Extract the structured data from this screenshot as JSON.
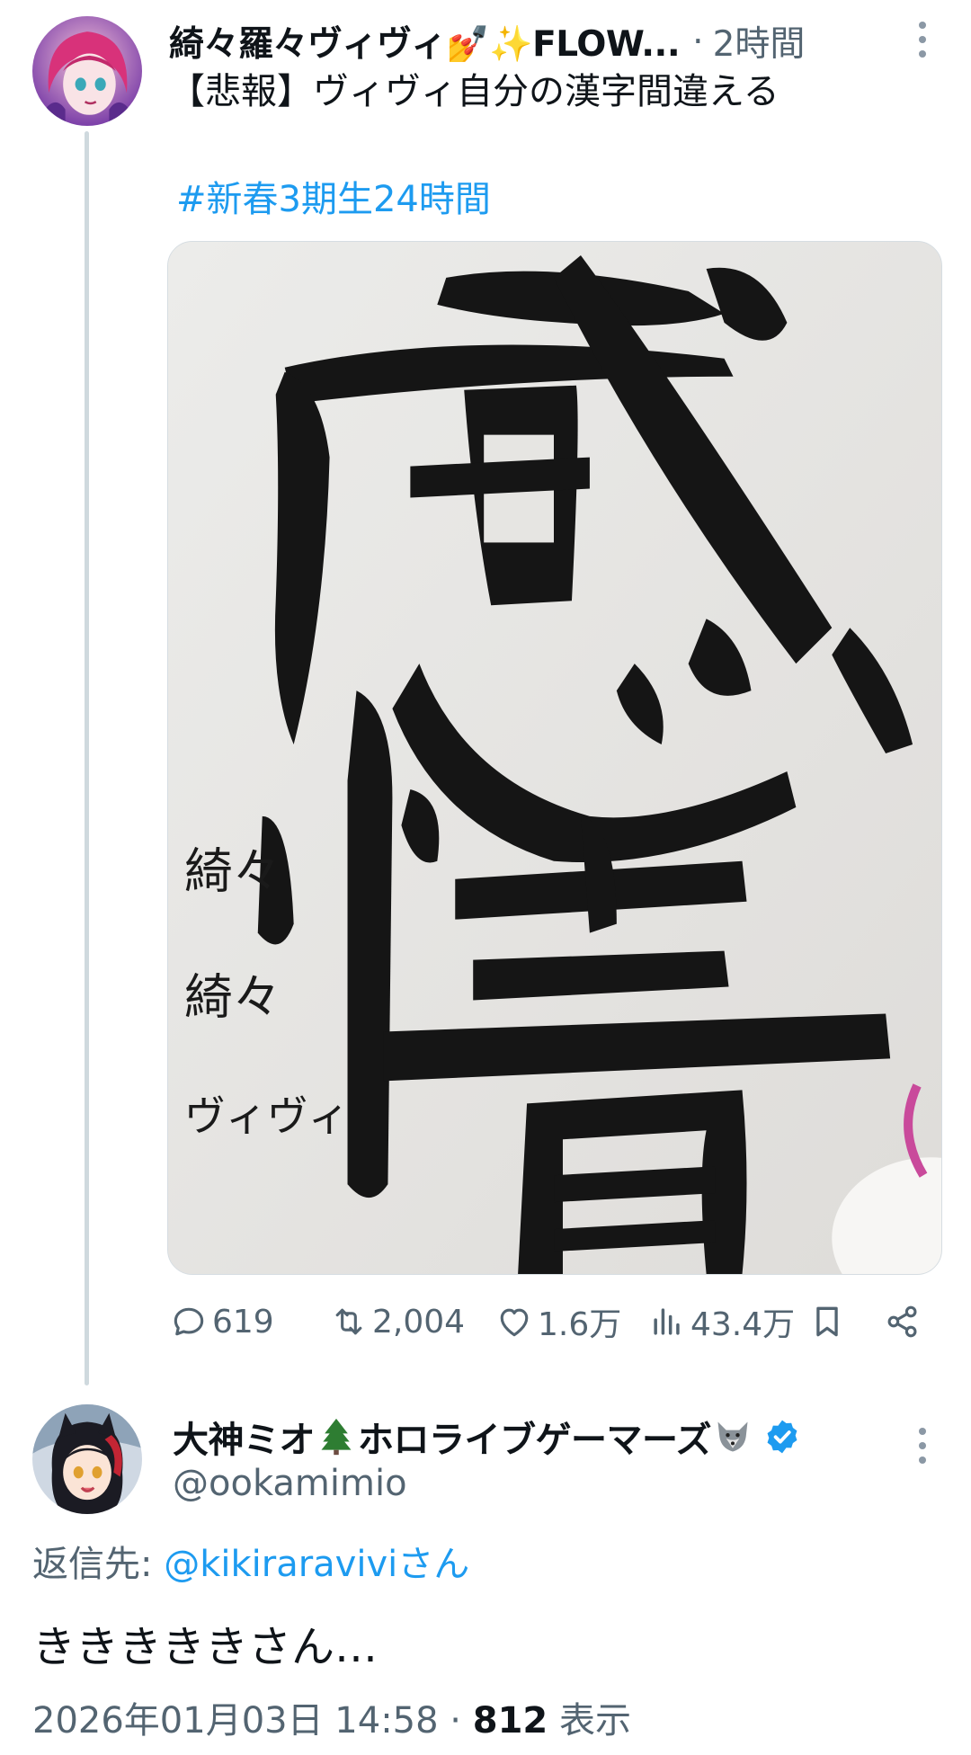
{
  "first_tweet": {
    "author_name": "綺々羅々ヴィヴィ💅✨FLOW...",
    "separator": "·",
    "time": "2時間",
    "text": "【悲報】ヴィヴィ自分の漢字間違える",
    "hashtag": "#新春3期生24時間",
    "image_text": {
      "main_characters": "感情",
      "signature_lines": [
        "綺々",
        "綺々",
        "ヴィヴィ"
      ]
    },
    "stats": {
      "replies": "619",
      "retweets": "2,004",
      "likes": "1.6万",
      "views": "43.4万"
    }
  },
  "second_tweet": {
    "author_name": "大神ミオ🌲ホロライブゲーマーズ",
    "author_name_parts": [
      "大神ミオ",
      "ホロライブゲーマーズ"
    ],
    "name_emojis": [
      "evergreen-tree-icon",
      "wolf-icon"
    ],
    "verified": true,
    "handle": "@ookamimio",
    "reply_to_label": "返信先: ",
    "reply_to_handle": "@kikiraravivi",
    "reply_to_suffix": "さん",
    "text": "きききききさん…",
    "date": "2026年01月03日 14:58",
    "meta_separator": " · ",
    "views_count": "812",
    "views_label": " 表示"
  },
  "colors": {
    "link": "#1d9bf0",
    "secondary_text": "#536471",
    "primary_text": "#0f1419",
    "thread_line": "#cfd9de"
  }
}
